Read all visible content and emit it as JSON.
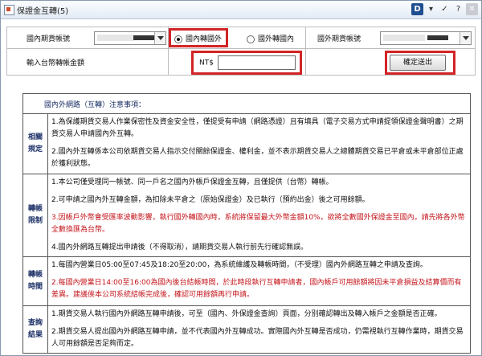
{
  "window": {
    "title": "保證金互轉(5)"
  },
  "titlebar_buttons": [
    {
      "name": "brand-icon",
      "glyph": "D"
    },
    {
      "name": "minimize-icon",
      "glyph": "▾"
    },
    {
      "name": "pin-icon",
      "glyph": "✓"
    },
    {
      "name": "help-icon",
      "glyph": "?"
    },
    {
      "name": "close-icon",
      "glyph": "✕"
    }
  ],
  "form": {
    "domestic_account_label": "國內期貨帳號",
    "radio_to_foreign": "國內轉國外",
    "radio_to_domestic": "國外轉國內",
    "foreign_account_label": "國外期貨帳號",
    "amount_label": "輸入台幣轉帳金額",
    "currency_prefix": "NT$",
    "submit_label": "確定送出",
    "selected_direction": "國內轉國外"
  },
  "notes": {
    "heading": "國內外網路（互轉）注意事項：",
    "sections": [
      {
        "title_line1": "相關",
        "title_line2": "規定",
        "items": [
          {
            "text": "1.為保護期貨交易人作業保密性及資金安全性，僅提受有申請（網路憑證）且有填具（電子交易方式申請提領保證金聲明書）之期貨交易人申請國內外互轉。",
            "red": false
          },
          {
            "text": "2.國內外互轉係本公司依期貨交易人指示交付關餘保證金、權利金，並不表示期貨交易人之總體期貨交易已平倉或未平倉部位正處於獲利狀態。",
            "red": false
          }
        ]
      },
      {
        "title_line1": "轉帳",
        "title_line2": "限制",
        "items": [
          {
            "text": "1.本公司僅受理同一帳號、同一戶名之國內外帳戶保證金互轉，且僅提供（台幣）轉帳。",
            "red": false
          },
          {
            "text": "2.可申請之國內外互轉金額，為扣除未平倉之（原始保證金）及已執行（預約出金）後之可用餘額。",
            "red": false
          },
          {
            "text": "3.因帳戶外幣會受匯率波動影響，執行國外轉國內時，系統將保留最大外幣金額10%，欲將全數國外保證金至國內，請先將各外幣全數換匯為台幣。",
            "red": true
          },
          {
            "text": "4.國內外網路互轉提出申請後（不得取消），請期貨交易人執行前先行確認無誤。",
            "red": false
          }
        ]
      },
      {
        "title_line1": "轉帳",
        "title_line2": "時間",
        "items": [
          {
            "text": "1.每國內營業日05:00至07:45及18:20至20:00，為系統維護及轉帳時間，（不受理）國內外網路互轉之申請及查詢。",
            "red": false
          },
          {
            "text": "2.每國內營業日14:00至16:00為國內後台結帳時間，於此時段執行互轉申請者，國內帳戶可用餘額將因未平倉損益及結算價而有差異。建議俟本公司系統結帳完成後，確認可用餘額再行申請。",
            "red": true
          }
        ]
      },
      {
        "title_line1": "查詢",
        "title_line2": "結果",
        "items": [
          {
            "text": "1.期貨交易人執行國內外網路互轉申請後，可至（國內、外保證金查詢）頁面，分別確認轉出及轉入帳戶之金額是否正確。",
            "red": false
          },
          {
            "text": "2.期貨交易人提出國內外網路互轉申請，並不代表國內外互轉成功。實際國內外互轉是否成功，仍需視執行互轉作業時，期貨交易人可用餘額是否足夠而定。",
            "red": false
          }
        ]
      }
    ]
  }
}
